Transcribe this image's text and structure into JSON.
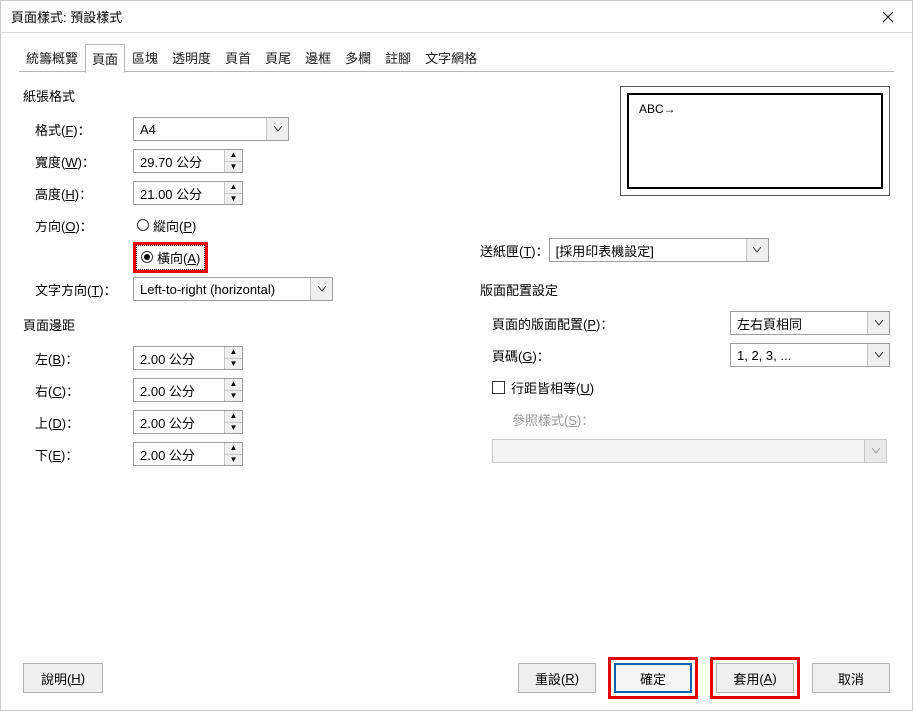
{
  "window": {
    "title": "頁面樣式: 預設樣式"
  },
  "tabs": {
    "items": [
      "統籌概覽",
      "頁面",
      "區塊",
      "透明度",
      "頁首",
      "頁尾",
      "邊框",
      "多欄",
      "註腳",
      "文字網格"
    ],
    "active_index": 1
  },
  "paper_format": {
    "section_title": "紙張格式",
    "format_label": "格式(F)：",
    "format_value": "A4",
    "width_label": "寬度(W)：",
    "width_value": "29.70 公分",
    "height_label": "高度(H)：",
    "height_value": "21.00 公分",
    "orientation_label": "方向(O)：",
    "portrait_label": "縱向(P)",
    "landscape_label": "橫向(A)",
    "text_dir_label": "文字方向(T)：",
    "text_dir_value": "Left-to-right (horizontal)"
  },
  "preview": {
    "text": "ABC→"
  },
  "paper_tray": {
    "label": "送紙匣(T)：",
    "value": "[採用印表機設定]"
  },
  "margins": {
    "section_title": "頁面邊距",
    "left_label": "左(B)：",
    "left_value": "2.00 公分",
    "right_label": "右(C)：",
    "right_value": "2.00 公分",
    "top_label": "上(D)：",
    "top_value": "2.00 公分",
    "bottom_label": "下(E)：",
    "bottom_value": "2.00 公分"
  },
  "layout": {
    "section_title": "版面配置設定",
    "page_layout_label": "頁面的版面配置(P)：",
    "page_layout_value": "左右頁相同",
    "page_number_label": "頁碼(G)：",
    "page_number_value": "1, 2, 3, ...",
    "line_spacing_label": "行距皆相等(U)",
    "ref_style_label": "參照樣式(S)：",
    "ref_style_value": ""
  },
  "footer": {
    "help": "說明(H)",
    "reset": "重設(R)",
    "ok": "確定",
    "apply": "套用(A)",
    "cancel": "取消"
  }
}
